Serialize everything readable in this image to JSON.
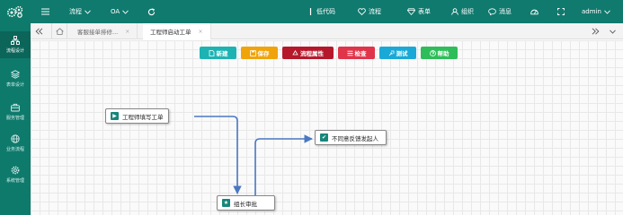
{
  "sidebar": {
    "items": [
      {
        "label": "流程设计",
        "icon": "flow-design-icon"
      },
      {
        "label": "表单设计",
        "icon": "layers-icon"
      },
      {
        "label": "服务管理",
        "icon": "briefcase-icon"
      },
      {
        "label": "业务流程",
        "icon": "globe-icon"
      },
      {
        "label": "系统管理",
        "icon": "settings-icon"
      }
    ]
  },
  "topbar": {
    "menu1": "流程",
    "menu2": "OA",
    "lowcode": "低代码",
    "flow": "流程",
    "form": "表单",
    "org": "组织",
    "msg": "消息",
    "user": "admin"
  },
  "tabs": {
    "tab1": "客服接单排修...",
    "tab2": "工程师启动工单"
  },
  "toolbar": {
    "new": "新建",
    "save": "保存",
    "props": "流程属性",
    "check": "检查",
    "test": "测试",
    "help": "帮助",
    "colors": {
      "new": "#1db3b3",
      "save": "#f0a30a",
      "props": "#b5182b",
      "check": "#e0344a",
      "test": "#1aa9d6",
      "help": "#2ebd59"
    }
  },
  "nodes": {
    "start": "工程师填写工单",
    "end": "不同意反馈发起人",
    "approve": "组长审批"
  }
}
